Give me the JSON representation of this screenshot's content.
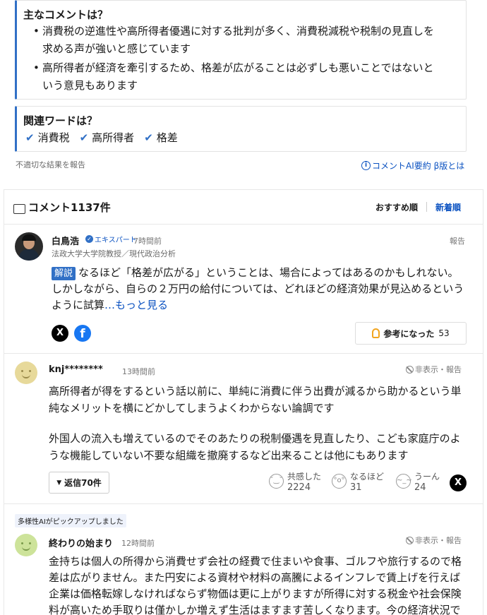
{
  "summary": {
    "title": "主なコメントは？",
    "bullets": [
      [
        "消費税の逆進性や高所得者優遇に対する批判が多く、消費税減税や税制の見直しを",
        "求める声が強いと感じています"
      ],
      [
        "高所得者が経済を牽引するため、格差が広がることは必ずしも悪いことではないと",
        "いう意見もあります"
      ]
    ]
  },
  "related": {
    "title": "関連ワードは？",
    "words": [
      "消費税",
      "高所得者",
      "格差"
    ]
  },
  "report_link": "不適切な結果を報告",
  "ai_info_link": "コメントAI要約 β版とは",
  "comments_header": {
    "title": "コメント1137件",
    "sort_recommended": "おすすめ順",
    "sort_newest": "新着順"
  },
  "expert_comment": {
    "name": "白鳥浩",
    "badge": "エキスパート",
    "time": "7時間前",
    "affiliation": "法政大学大学院教授／現代政治分析",
    "report": "報告",
    "tag": "解説",
    "lines": [
      "なるほど「格差が広がる」ということは、場合によってはあるのかもしれない。",
      "しかしながら、自らの２万円の給付については、どれほどの経済効果が見込めるという",
      "ように試算"
    ],
    "more": "…もっと見る",
    "helpful_label": "参考になった",
    "helpful_count": "53"
  },
  "comment1": {
    "name": "knj********",
    "time": "13時間前",
    "actions": "非表示・報告",
    "paragraph1": [
      "高所得者が得をするという話以前に、単純に消費に伴う出費が減るから助かるという単",
      "純なメリットを横にどかしてしまうよくわからない論調です"
    ],
    "paragraph2": [
      "外国人の流入も増えているのでそのあたりの税制優遇を見直したり、こども家庭庁のよ",
      "うな機能していない不要な組織を撤廃するなど出来ることは他にもあります"
    ],
    "replies": "返信70件",
    "reactions": [
      {
        "label": "共感した",
        "count": "2224"
      },
      {
        "label": "なるほど",
        "count": "31"
      },
      {
        "label": "うーん",
        "count": "24"
      }
    ]
  },
  "comment2": {
    "pickup": "多様性AIがピックアップしました",
    "name": "終わりの始まり",
    "time": "12時間前",
    "actions": "非表示・報告",
    "lines": [
      "金持ちは個人の所得から消費せず会社の経費で住まいや食事、ゴルフや旅行するので格",
      "差は広がりません。また円安による資材や材料の高騰によるインフレで賃上げを行えば",
      "企業は価格転嫁しなければならず物価は更に上がりますが所得に対する税金や社会保険",
      "料が高いため手取りは僅かしか増えず生活はますます苦しくなります。今の経済状況で"
    ]
  },
  "colors": {
    "accent": "#3170c6",
    "link": "#0b52c1",
    "tag_bg": "#3170c6",
    "helpful_icon": "#f2a51f"
  }
}
